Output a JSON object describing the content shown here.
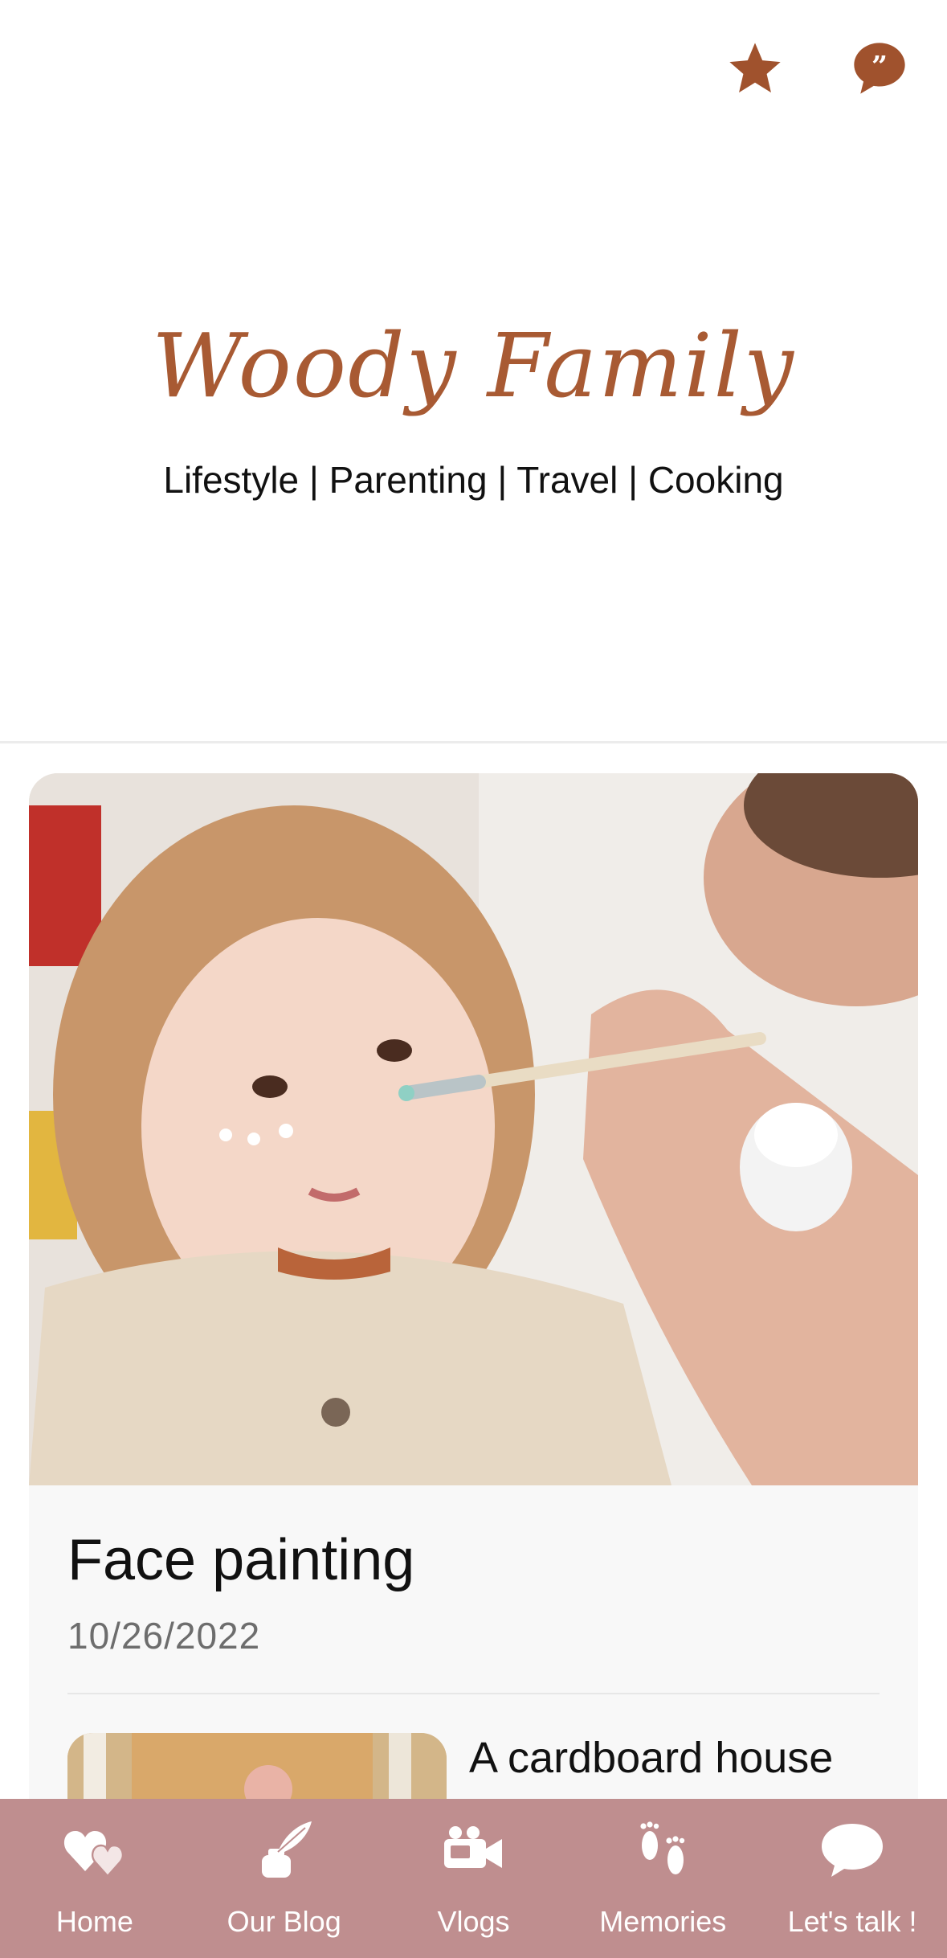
{
  "header": {
    "actions": [
      {
        "icon": "star-icon",
        "color": "#a0522d"
      },
      {
        "icon": "quote-bubble-icon",
        "color": "#a0522d"
      }
    ]
  },
  "hero": {
    "brand": "Woody Family",
    "tagline": "Lifestyle | Parenting | Travel | Cooking",
    "brand_color": "#a85a33"
  },
  "featured_post": {
    "title": "Face painting",
    "date": "10/26/2022"
  },
  "next_post": {
    "title": "A cardboard house"
  },
  "bottom_nav": {
    "background": "#bf8e8f",
    "items": [
      {
        "label": "Home",
        "icon": "hearts-icon"
      },
      {
        "label": "Our Blog",
        "icon": "quill-inkpot-icon"
      },
      {
        "label": "Vlogs",
        "icon": "video-camera-icon"
      },
      {
        "label": "Memories",
        "icon": "footprints-icon"
      },
      {
        "label": "Let's talk !",
        "icon": "chat-bubble-icon"
      }
    ]
  }
}
